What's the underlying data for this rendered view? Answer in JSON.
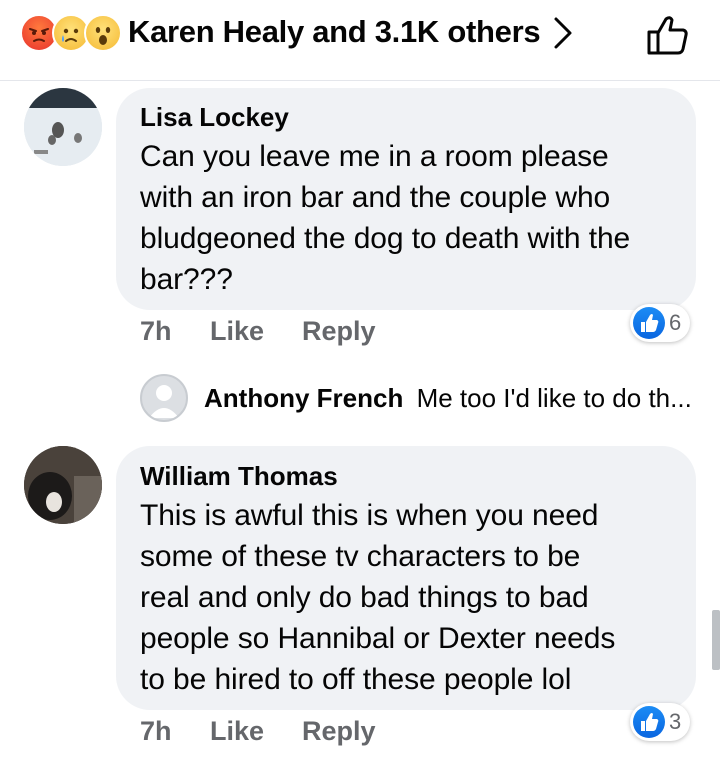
{
  "header": {
    "reaction_icons": [
      "angry-face-icon",
      "sad-face-icon",
      "wow-face-icon"
    ],
    "summary": "Karen Healy and 3.1K others",
    "colors": {
      "like_blue": "#1877f2",
      "meta_gray": "#65676b",
      "bubble_bg": "#f0f2f5"
    }
  },
  "comments": [
    {
      "author": "Lisa Lockey",
      "lines": [
        "Can you leave me in a room please",
        "with an iron bar and the couple who",
        "bludgeoned the dog to death with the",
        "bar???"
      ],
      "time": "7h",
      "like_label": "Like",
      "reply_label": "Reply",
      "like_count": "6",
      "reply_preview": {
        "author": "Anthony French",
        "text": "Me too I'd like to do th..."
      }
    },
    {
      "author": "William Thomas",
      "lines": [
        "This is awful this is when you need",
        "some of these tv characters to be",
        "real and only do bad things to bad",
        "people so Hannibal or Dexter needs",
        "to be hired to off these people lol"
      ],
      "time": "7h",
      "like_label": "Like",
      "reply_label": "Reply",
      "like_count": "3"
    }
  ]
}
